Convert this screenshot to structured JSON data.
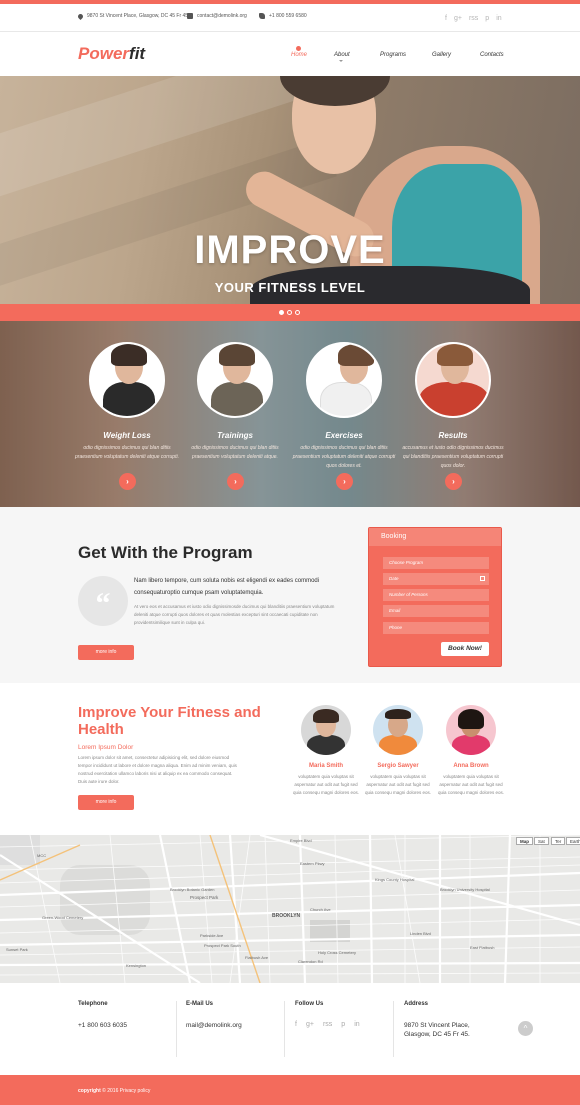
{
  "topbar": {
    "address": "9870 St Vincent Place, Glasgow, DC 45 Fr 45.",
    "email": "contact@demolink.org",
    "phone": "+1 800 559 6580",
    "social": [
      "f",
      "g+",
      "rss",
      "p",
      "in"
    ]
  },
  "header": {
    "logo_part1": "Power",
    "logo_part2": "fit",
    "nav": [
      "Home",
      "About",
      "Programs",
      "Gallery",
      "Contacts"
    ],
    "active": "Home"
  },
  "hero": {
    "title": "IMPROVE",
    "subtitle": "YOUR FITNESS LEVEL",
    "slides": 3,
    "active_slide": 1
  },
  "services": [
    {
      "title": "Weight Loss",
      "text": "odio dignissimos ducimus qui blan ditiis praesentium voluptatum deleniti atque corrupti.",
      "button": "›"
    },
    {
      "title": "Trainings",
      "text": "odio dignissimos ducimus qui blan ditiis praesentium voluptatum deleniti atque.",
      "button": "›"
    },
    {
      "title": "Exercises",
      "text": "odio dignissimos ducimus qui blan ditiis praesentium voluptatum deleniti atque corrupti quos dolores et.",
      "button": "›"
    },
    {
      "title": "Results",
      "text": "accusamus et iusto odio dignissimos ducimus qui blanditiis praesentium voluptatum corrupti quos dolor.",
      "button": "›"
    }
  ],
  "program": {
    "title": "Get With the Program",
    "quote_glyph": "“",
    "lead": "Nam libero tempore, cum soluta nobis est eligendi ex eades commodi consequaturoptio cumque psam voluptatemquia.",
    "body": "At vero eos et accusamus et iusto odio dignissimosde ducimus qui blanditiis praesentium voluptatum deleniti atque corrupti quos dolores et quas molestias excepturi sint occaecati cupiditate non providentsimilique sunt in culpa qui.",
    "button": "more info"
  },
  "booking": {
    "title": "Booking",
    "fields": [
      "Choose Program",
      "Date",
      "Number of Persons",
      "Email",
      "Phone"
    ],
    "button": "Book Now!"
  },
  "fitness": {
    "title": "Improve Your Fitness and Health",
    "lead": "Lorem Ipsum Dolor",
    "body": "Lorem ipsum dolor sit amet, consectetur adipisicing elit, sed dolore eiusmod tempor incididunt ut labore et dolore magna aliqua. Enim ad minim veniam, quis nostrud exercitation ullamco laboris nisi ut aliquip ex ea commodo consequat. Duis aute irure dolor.",
    "button": "more info",
    "trainers": [
      {
        "name": "Maria Smith",
        "text": "voluptatem quia voluptas sit aspernatur aut odit aut fugit sed quia consequ magni dolores eos."
      },
      {
        "name": "Sergio Sawyer",
        "text": "voluptatem quia voluptas sit aspernatur aut odit aut fugit sed quia consequ magni dolores eos."
      },
      {
        "name": "Anna Brown",
        "text": "voluptatem quia voluptas sit aspernatur aut odit aut fugit sed quia consequ magni dolores eos."
      }
    ]
  },
  "map": {
    "controls": [
      "Map",
      "Sat",
      "Ter",
      "Earth"
    ],
    "labels": [
      "BROOKLYN",
      "Prospect Park",
      "Brooklyn Botanic Garden",
      "Empire Blvd",
      "Church Ave",
      "Flatbush Ave",
      "Eastern Pkwy",
      "Kings County Hospital",
      "Brooklyn University Hospital",
      "Holy Cross Cemetery",
      "Clarendon Rd",
      "Linden Blvd",
      "East Flatbush",
      "Green-Wood Cemetery",
      "Parkside Ave",
      "MCC",
      "Kensington",
      "Prospect Park South",
      "Sunset Park"
    ]
  },
  "footer": {
    "telephone_label": "Telephone",
    "telephone": "+1 800 603 6035",
    "email_label": "E-Mail Us",
    "email": "mail@demolink.org",
    "follow_label": "Follow Us",
    "social": [
      "f",
      "g+",
      "rss",
      "p",
      "in"
    ],
    "address_label": "Address",
    "address_line1": "9870 St Vincent Place,",
    "address_line2": "Glasgow, DC 45 Fr 45.",
    "to_top": "^"
  },
  "copyright": {
    "label": "copyright",
    "text": "© 2016 Privacy policy"
  },
  "colors": {
    "accent": "#f36b5c",
    "dark": "#2b2b2b",
    "muted": "#888888"
  }
}
